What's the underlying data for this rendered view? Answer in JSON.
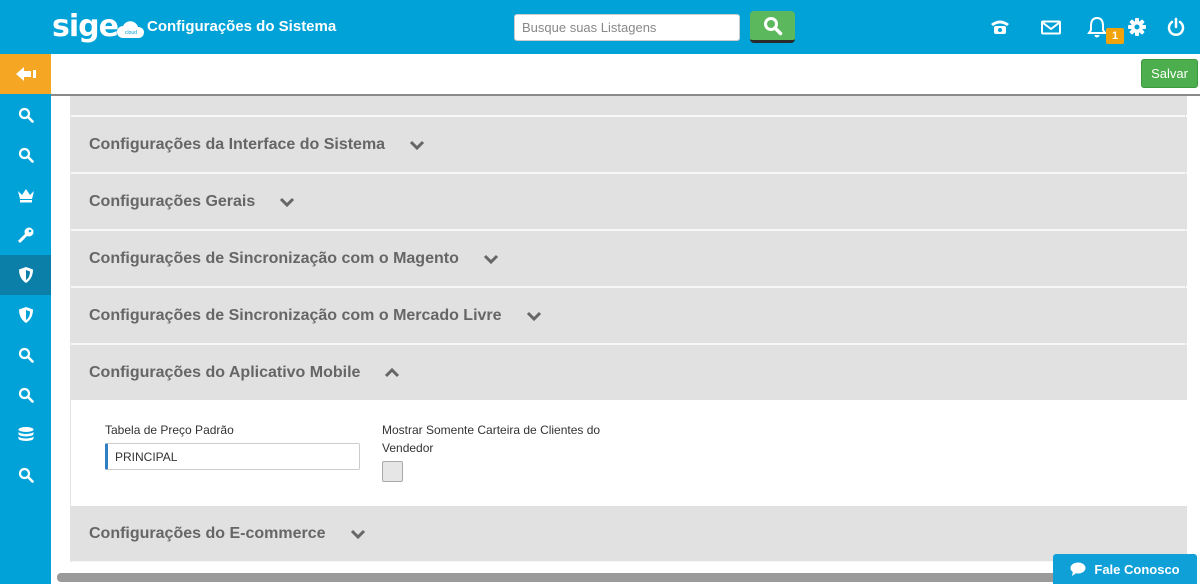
{
  "header": {
    "logo_text": "sige",
    "logo_cloud_text": "cloud",
    "title": "Configurações do Sistema",
    "search_placeholder": "Busque suas Listagens",
    "notification_count": "1"
  },
  "toolbar": {
    "save_label": "Salvar"
  },
  "sections": [
    {
      "title": "Configurações da Interface do Sistema",
      "expanded": false
    },
    {
      "title": "Configurações Gerais",
      "expanded": false
    },
    {
      "title": "Configurações de Sincronização com o Magento",
      "expanded": false
    },
    {
      "title": "Configurações de Sincronização com o Mercado Livre",
      "expanded": false
    },
    {
      "title": "Configurações do Aplicativo Mobile",
      "expanded": true
    },
    {
      "title": "Configurações do E-commerce",
      "expanded": false
    }
  ],
  "mobile": {
    "price_table_label": "Tabela de Preço Padrão",
    "price_table_value": "PRINCIPAL",
    "only_clients_label_line1": "Mostrar Somente Carteira de Clientes do",
    "only_clients_label_line2": "Vendedor",
    "only_clients_checked": false
  },
  "chat": {
    "label": "Fale Conosco"
  },
  "colors": {
    "brand_blue": "#00a2d8",
    "back_orange": "#f5a623",
    "save_green": "#4cae4c"
  }
}
